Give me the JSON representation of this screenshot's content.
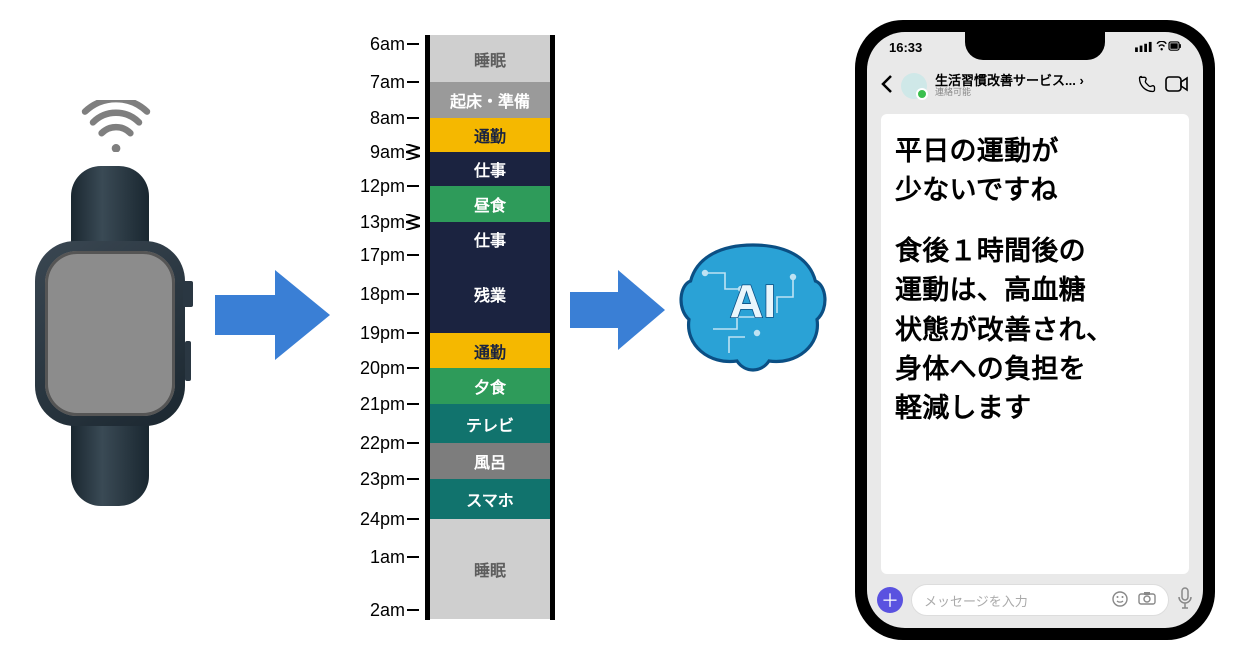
{
  "timeline": {
    "ticks": [
      "6am",
      "7am",
      "8am",
      "9am",
      "12pm",
      "13pm",
      "17pm",
      "18pm",
      "19pm",
      "20pm",
      "21pm",
      "22pm",
      "23pm",
      "24pm",
      "1am",
      "2am"
    ],
    "blocks": [
      {
        "label": "睡眠",
        "class": "sleep"
      },
      {
        "label": "起床・準備",
        "class": "prep"
      },
      {
        "label": "通勤",
        "class": "commute"
      },
      {
        "label": "仕事",
        "class": "work"
      },
      {
        "label": "昼食",
        "class": "lunch"
      },
      {
        "label": "仕事",
        "class": "work"
      },
      {
        "label": "残業",
        "class": "over"
      },
      {
        "label": "通勤",
        "class": "commute"
      },
      {
        "label": "夕食",
        "class": "dinner"
      },
      {
        "label": "テレビ",
        "class": "tv"
      },
      {
        "label": "風呂",
        "class": "bath"
      },
      {
        "label": "スマホ",
        "class": "phonet"
      },
      {
        "label": "睡眠",
        "class": "sleep"
      }
    ]
  },
  "ai_label": "AI",
  "phone": {
    "time": "16:33",
    "header_title": "生活習慣改善サービス...",
    "header_sub": "連絡可能",
    "header_caret": "›",
    "message_l1": "平日の運動が",
    "message_l2": "少ないですね",
    "message_l3": "食後１時間後の",
    "message_l4": "運動は、高血糖",
    "message_l5": "状態が改善され、",
    "message_l6": "身体への負担を",
    "message_l7": "軽減します",
    "input_placeholder": "メッセージを入力"
  }
}
